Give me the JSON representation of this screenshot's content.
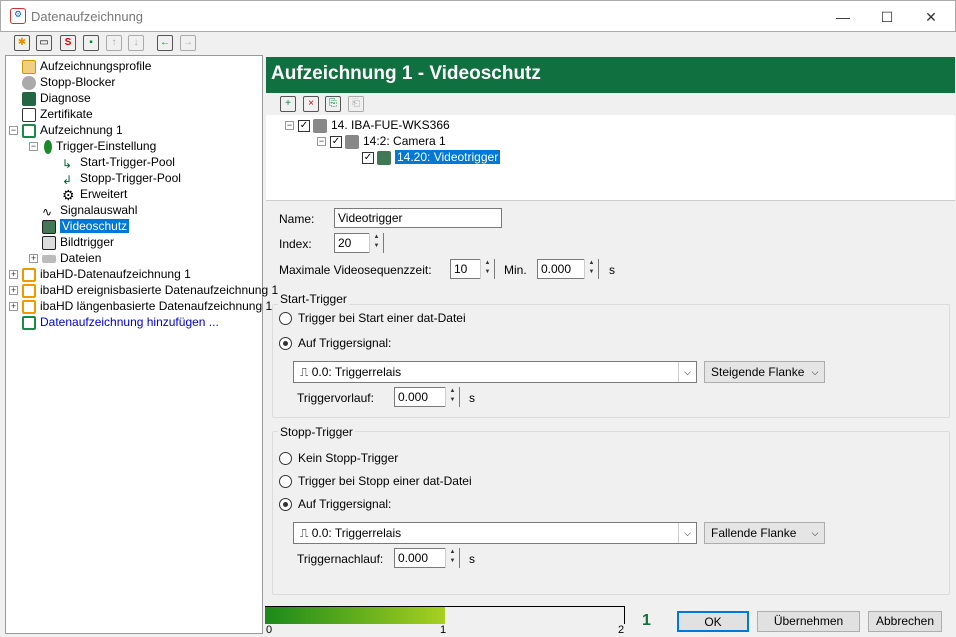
{
  "window": {
    "title": "Datenaufzeichnung",
    "minimize": "—",
    "maximize": "☐",
    "close": "✕"
  },
  "toolbar": [
    {
      "name": "new",
      "glyph": "✱"
    },
    {
      "name": "open",
      "glyph": "▭"
    },
    {
      "name": "open-s",
      "glyph": "S"
    },
    {
      "name": "save",
      "glyph": "▪"
    },
    {
      "name": "up",
      "glyph": "↑"
    },
    {
      "name": "down",
      "glyph": "↓"
    },
    {
      "name": "back",
      "glyph": "←"
    },
    {
      "name": "forward",
      "glyph": "→"
    }
  ],
  "tree": {
    "items": [
      "Aufzeichnungsprofile",
      "Stopp-Blocker",
      "Diagnose",
      "Zertifikate",
      "Aufzeichnung 1",
      "Trigger-Einstellung",
      "Start-Trigger-Pool",
      "Stopp-Trigger-Pool",
      "Erweitert",
      "Signalauswahl",
      "Videoschutz",
      "Bildtrigger",
      "Dateien",
      "ibaHD-Datenaufzeichnung 1",
      "ibaHD ereignisbasierte Datenaufzeichnung 1",
      "ibaHD längenbasierte Datenaufzeichnung 1",
      "Datenaufzeichnung hinzufügen ..."
    ]
  },
  "header": {
    "title": "Aufzeichnung 1 - Videoschutz",
    "color": "#107040"
  },
  "device_tree": {
    "server": "14. IBA-FUE-WKS366",
    "camera": "14:2: Camera 1",
    "trigger": "14.20: Videotrigger"
  },
  "form": {
    "name_label": "Name:",
    "name_value": "Videotrigger",
    "index_label": "Index:",
    "index_value": "20",
    "maxseq_label": "Maximale Videosequenzzeit:",
    "maxseq_value": "10",
    "min_label": "Min.",
    "sec_value": "0.000",
    "s_label": "s",
    "start": {
      "title": "Start-Trigger",
      "opt1": "Trigger bei Start einer dat-Datei",
      "opt2": "Auf Triggersignal:",
      "signal": "0.0: Triggerrelais",
      "edge": "Steigende Flanke",
      "pre_label": "Triggervorlauf:",
      "pre_value": "0.000",
      "unit": "s"
    },
    "stop": {
      "title": "Stopp-Trigger",
      "opt1": "Kein Stopp-Trigger",
      "opt2": "Trigger bei Stopp einer dat-Datei",
      "opt3": "Auf Triggersignal:",
      "signal": "0.0: Triggerrelais",
      "edge": "Fallende Flanke",
      "post_label": "Triggernachlauf:",
      "post_value": "0.000",
      "unit": "s"
    }
  },
  "footer": {
    "progress_fraction": 0.5,
    "scale": [
      "0",
      "1",
      "2"
    ],
    "count": "1",
    "ok": "OK",
    "apply": "Übernehmen",
    "cancel": "Abbrechen"
  }
}
